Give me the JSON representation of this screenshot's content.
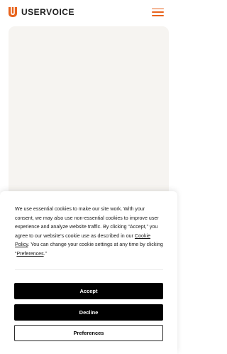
{
  "header": {
    "brand": "USERVOICE",
    "logo_icon": "uservoice-logo-icon",
    "menu_icon": "hamburger-menu-icon",
    "accent_color": "#e8631c"
  },
  "cookie_banner": {
    "text_before_policy": "We use essential cookies to make our site work. With your consent, we may also use non-essential cookies to improve user experience and analyze website traffic. By clicking “Accept,” you agree to our website's cookie use as described in our ",
    "policy_link": "Cookie Policy",
    "text_after_policy": ". You can change your cookie settings at any time by clicking “",
    "preferences_link": "Preferences",
    "text_end": ".”",
    "accept_label": "Accept",
    "decline_label": "Decline",
    "preferences_label": "Preferences"
  }
}
